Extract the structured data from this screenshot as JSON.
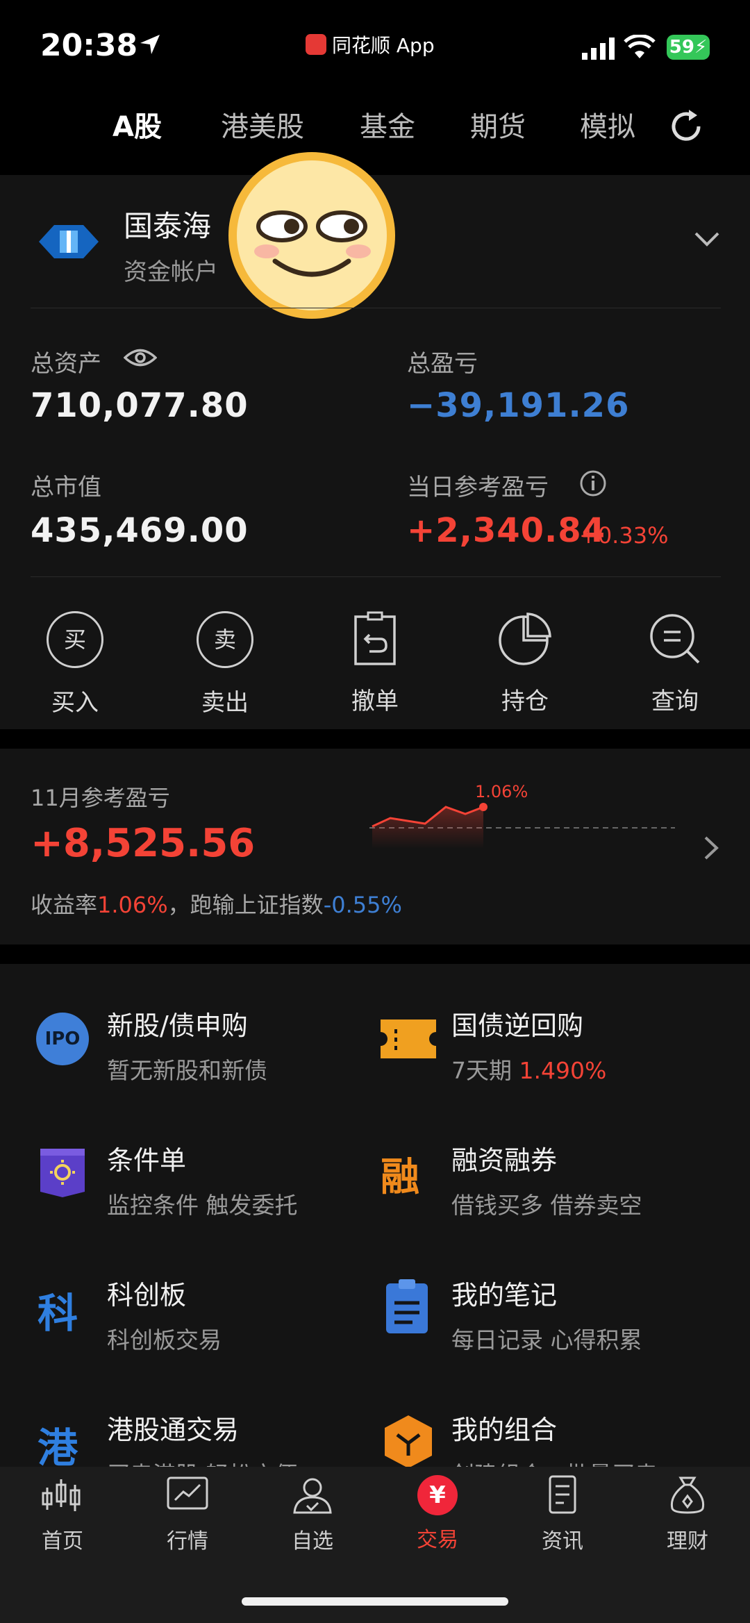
{
  "status": {
    "time": "20:38",
    "app_name": "同花顺 App",
    "battery": "59"
  },
  "tabs": [
    {
      "label": "A股",
      "active": true
    },
    {
      "label": "港美股"
    },
    {
      "label": "基金"
    },
    {
      "label": "期货"
    },
    {
      "label": "模拟"
    }
  ],
  "account": {
    "name": "国泰海",
    "sub": "资金帐户"
  },
  "summary": {
    "total_assets_label": "总资产",
    "total_assets": "710,077.80",
    "total_pl_label": "总盈亏",
    "total_pl": "−39,191.26",
    "market_value_label": "总市值",
    "market_value": "435,469.00",
    "daily_pl_label": "当日参考盈亏",
    "daily_pl": "+2,340.84",
    "daily_pl_pct": "+0.33%"
  },
  "actions": [
    {
      "label": "买入",
      "glyph": "买"
    },
    {
      "label": "卖出",
      "glyph": "卖"
    },
    {
      "label": "撤单",
      "glyph": "⤺"
    },
    {
      "label": "持仓",
      "glyph": "◔"
    },
    {
      "label": "查询",
      "glyph": "☰"
    }
  ],
  "monthly": {
    "label": "11月参考盈亏",
    "value": "+8,525.56",
    "rate_label": "收益率",
    "rate": "1.06%",
    "vs_label": "，跑输上证指数",
    "vs_value": "-0.55%",
    "spark_label": "1.06%"
  },
  "features": [
    {
      "title": "新股/债申购",
      "sub": "暂无新股和新债",
      "icon": "ipo-icon"
    },
    {
      "title": "国债逆回购",
      "sub_prefix": "7天期 ",
      "sub_highlight": "1.490%",
      "icon": "ticket-icon"
    },
    {
      "title": "条件单",
      "sub": "监控条件 触发委托",
      "icon": "condition-order-icon"
    },
    {
      "title": "融资融券",
      "sub": "借钱买多 借券卖空",
      "icon": "margin-icon",
      "glyph": "融"
    },
    {
      "title": "科创板",
      "sub": "科创板交易",
      "icon": "star-market-icon",
      "glyph": "科"
    },
    {
      "title": "我的笔记",
      "sub": "每日记录 心得积累",
      "icon": "notes-icon"
    },
    {
      "title": "港股通交易",
      "sub": "买卖港股 轻松方便",
      "icon": "hk-connect-icon",
      "glyph": "港"
    },
    {
      "title": "我的组合",
      "sub": "创建组合、批量买卖",
      "icon": "portfolio-icon"
    }
  ],
  "ipo_glyph": "IPO",
  "nav": [
    {
      "label": "首页"
    },
    {
      "label": "行情"
    },
    {
      "label": "自选"
    },
    {
      "label": "交易",
      "active": true,
      "glyph": "¥"
    },
    {
      "label": "资讯"
    },
    {
      "label": "理财"
    }
  ],
  "colors": {
    "up": "#f44336",
    "down": "#3e7fd3",
    "card": "#141414"
  }
}
